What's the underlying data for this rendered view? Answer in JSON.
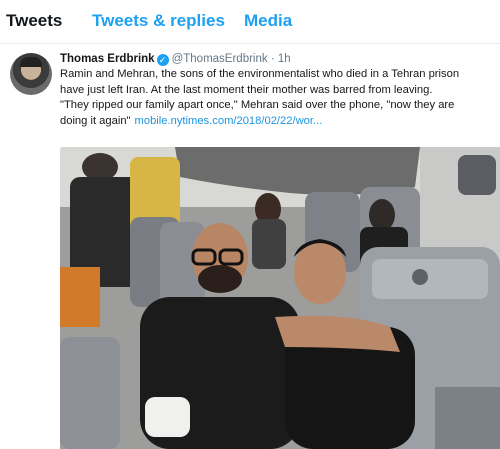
{
  "tabs": [
    {
      "label": "Tweets"
    },
    {
      "label": "Tweets & replies"
    },
    {
      "label": "Media"
    }
  ],
  "tweet": {
    "author_name": "Thomas Erdbrink",
    "verified_glyph": "✓",
    "handle": "@ThomasErdbrink",
    "separator": "·",
    "time": "1h",
    "lines": [
      "Ramin and Mehran, the sons of the environmentalist who died in a Tehran prison",
      "have just left Iran. At the last moment their mother was barred from leaving.",
      "\"They ripped our family apart once,\" Mehran said over the phone, \"now they are",
      "doing it again\""
    ],
    "link": "mobile.nytimes.com/2018/02/22/wor...",
    "icons": {
      "avatar": "profile-photo",
      "verified": "verified-badge-icon"
    },
    "colors": {
      "accent": "#1da1f2",
      "link": "#1b95e0",
      "muted": "#657786"
    }
  }
}
